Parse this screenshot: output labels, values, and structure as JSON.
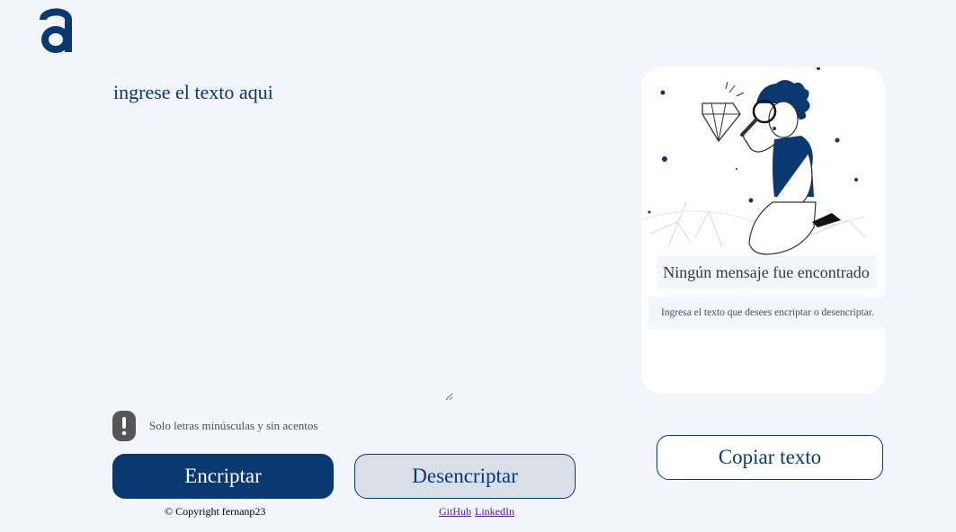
{
  "logo": {
    "icon": "alura-a-logo-icon",
    "color": "#0a3871"
  },
  "input": {
    "placeholder": "ingrese el texto aqui",
    "value": ""
  },
  "warning": {
    "icon": "exclamation-icon",
    "text": "Solo letras minúsculas y sin acentos"
  },
  "buttons": {
    "encrypt_label": "Encriptar",
    "decrypt_label": "Desencriptar",
    "copy_label": "Copiar texto"
  },
  "output_panel": {
    "illustration": "boy-with-magnifying-glass-illustration",
    "title": "Ningún mensaje fue encontrado",
    "message": "Ingresa el texto que desees encriptar o desencriptar."
  },
  "footer": {
    "copyright": "© Copyright fernanp23",
    "links": [
      "GitHub",
      "LinkedIn"
    ]
  },
  "colors": {
    "background": "#f3f5fc",
    "primary": "#0a3871",
    "secondary_button": "#d8dfe8",
    "panel": "#ffffff"
  }
}
